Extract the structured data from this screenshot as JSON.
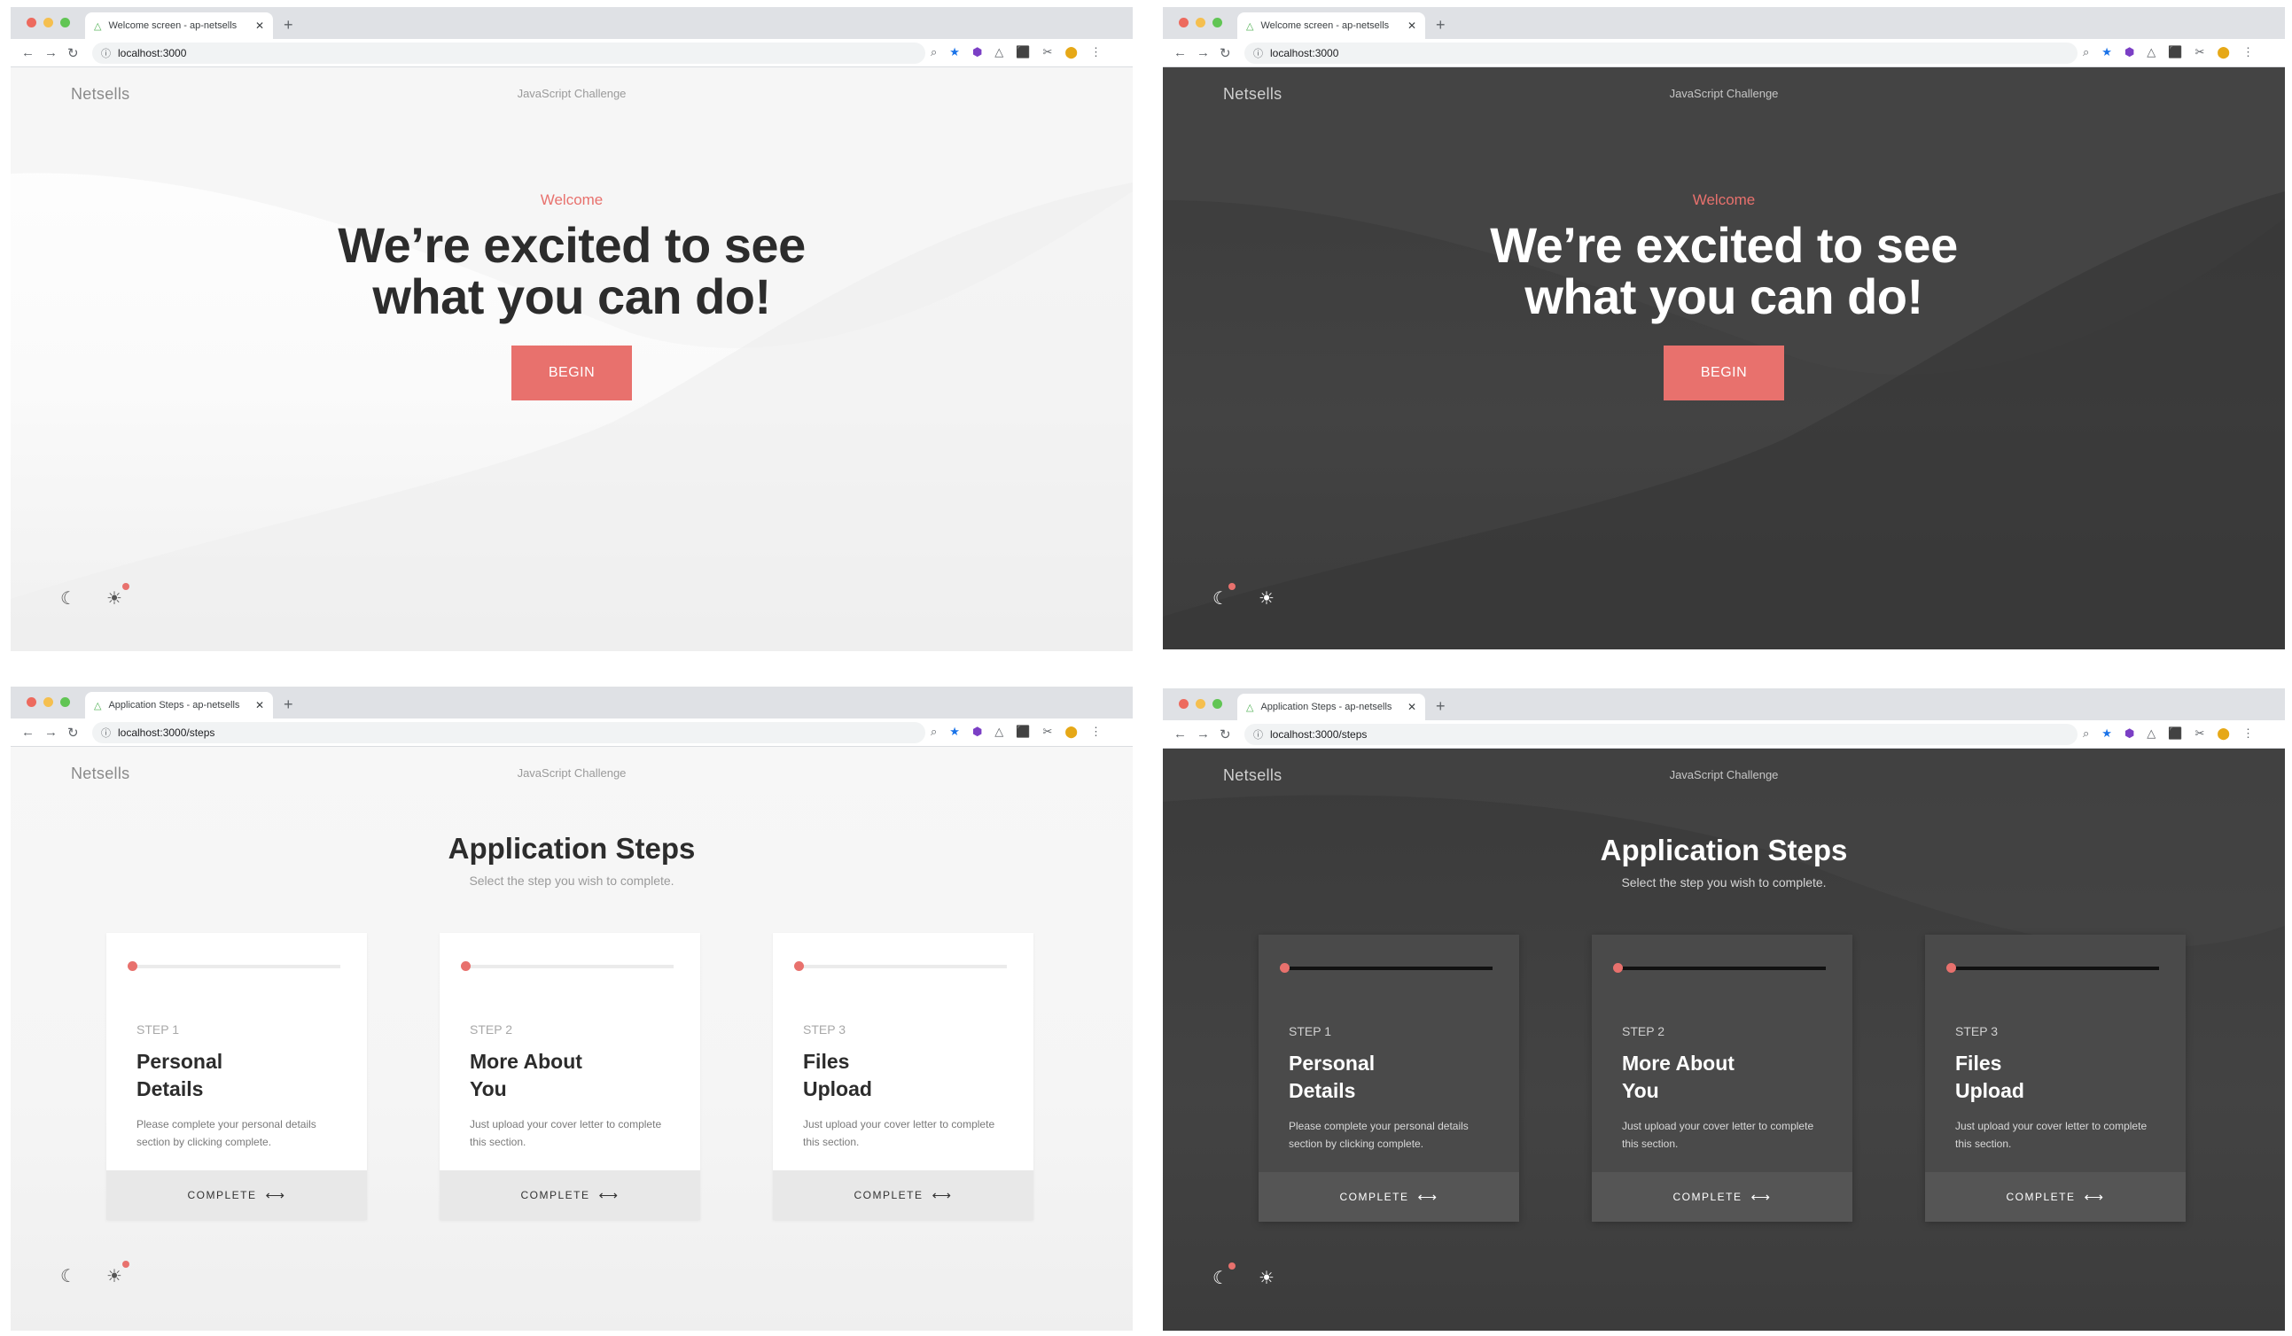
{
  "panels": [
    {
      "tab_title": "Welcome screen - ap-netsells",
      "url": "localhost:3000",
      "brand": "Netsells",
      "header_center": "JavaScript Challenge",
      "eyebrow": "Welcome",
      "headline_line1": "We’re excited to see",
      "headline_line2": "what you can do!",
      "begin_label": "BEGIN",
      "theme": "light"
    },
    {
      "tab_title": "Welcome screen - ap-netsells",
      "url": "localhost:3000",
      "brand": "Netsells",
      "header_center": "JavaScript Challenge",
      "eyebrow": "Welcome",
      "headline_line1": "We’re excited to see",
      "headline_line2": "what you can do!",
      "begin_label": "BEGIN",
      "theme": "dark"
    },
    {
      "tab_title": "Application Steps - ap-netsells",
      "url": "localhost:3000/steps",
      "brand": "Netsells",
      "header_center": "JavaScript Challenge",
      "title": "Application Steps",
      "subtitle": "Select the step you wish to complete.",
      "theme": "light",
      "cards": [
        {
          "step": "STEP 1",
          "title_line1": "Personal",
          "title_line2": "Details",
          "desc": "Please complete your personal details section by clicking complete.",
          "action": "COMPLETE"
        },
        {
          "step": "STEP 2",
          "title_line1": "More About",
          "title_line2": "You",
          "desc": "Just upload your cover letter to complete this section.",
          "action": "COMPLETE"
        },
        {
          "step": "STEP 3",
          "title_line1": "Files",
          "title_line2": "Upload",
          "desc": "Just upload your cover letter to complete this section.",
          "action": "COMPLETE"
        }
      ]
    },
    {
      "tab_title": "Application Steps - ap-netsells",
      "url": "localhost:3000/steps",
      "brand": "Netsells",
      "header_center": "JavaScript Challenge",
      "title": "Application Steps",
      "subtitle": "Select the step you wish to complete.",
      "theme": "dark",
      "cards": [
        {
          "step": "STEP 1",
          "title_line1": "Personal",
          "title_line2": "Details",
          "desc": "Please complete your personal details section by clicking complete.",
          "action": "COMPLETE"
        },
        {
          "step": "STEP 2",
          "title_line1": "More About",
          "title_line2": "You",
          "desc": "Just upload your cover letter to complete this section.",
          "action": "COMPLETE"
        },
        {
          "step": "STEP 3",
          "title_line1": "Files",
          "title_line2": "Upload",
          "desc": "Just upload your cover letter to complete this section.",
          "action": "COMPLETE"
        }
      ]
    }
  ],
  "icons": {
    "moon": "☾",
    "sun": "☀",
    "arrow": "⟷",
    "back": "←",
    "forward": "→",
    "reload": "↻",
    "info": "ⓘ",
    "new_tab": "+",
    "close": "✕",
    "toolbar": [
      "⌕",
      "★",
      "⬢",
      "△",
      "⬛",
      "✂",
      "⬤",
      "⋮"
    ]
  },
  "colors": {
    "accent": "#e8716d",
    "dark_bg": "#3e3e3e",
    "light_bg": "#f7f7f7"
  }
}
